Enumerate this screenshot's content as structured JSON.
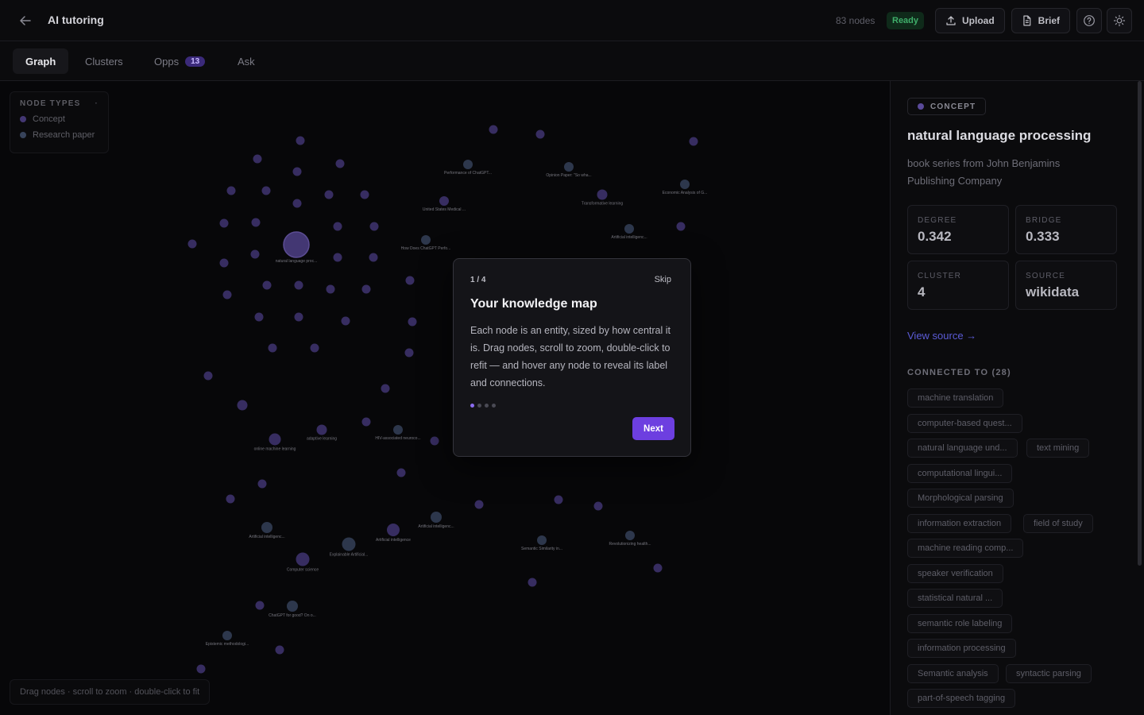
{
  "header": {
    "title": "AI tutoring",
    "node_count": "83 nodes",
    "status": "Ready",
    "upload_label": "Upload",
    "brief_label": "Brief"
  },
  "tabs": [
    {
      "label": "Graph"
    },
    {
      "label": "Clusters"
    },
    {
      "label": "Opps",
      "badge": "13"
    },
    {
      "label": "Ask"
    }
  ],
  "legend": {
    "title": "NODE TYPES",
    "items": [
      {
        "label": "Concept",
        "color": "#5a4a9a"
      },
      {
        "label": "Research paper",
        "color": "#4a5a7a"
      }
    ]
  },
  "graph_hint": "Drag nodes · scroll to zoom · double-click to fit",
  "graph": {
    "node_labels": [
      "natural language proc...",
      "Performance of ChatGPT...",
      "Opinion Paper: \"So wha...",
      "Economic Analysis of G...",
      "United States Medical ...",
      "Transformative learning",
      "How Does ChatGPT Perfo...",
      "Artificial intelligenc...",
      "online machine learning",
      "adaptive learning",
      "HIV-associated neuroco...",
      "Artificial intelligenc...",
      "Explainable Artificial...",
      "Artificial intelligence",
      "Artificial intelligenc...",
      "Semantic Similarity in...",
      "Revolutionizing health...",
      "Computer science",
      "ChatGPT for good? On o...",
      "Epistemic methodologi..."
    ]
  },
  "tour": {
    "step": "1 / 4",
    "skip": "Skip",
    "title": "Your knowledge map",
    "body": "Each node is an entity, sized by how central it is. Drag nodes, scroll to zoom, double-click to refit — and hover any node to reveal its label and connections.",
    "next": "Next",
    "current": 1,
    "total": 4
  },
  "panel": {
    "type": "CONCEPT",
    "title": "natural language processing",
    "description": "book series from John Benjamins Publishing Company",
    "stats": [
      {
        "label": "DEGREE",
        "value": "0.342"
      },
      {
        "label": "BRIDGE",
        "value": "0.333"
      },
      {
        "label": "CLUSTER",
        "value": "4"
      },
      {
        "label": "SOURCE",
        "value": "wikidata"
      }
    ],
    "view_source": "View source →",
    "connected_title": "CONNECTED TO (28)",
    "connections": [
      "machine translation",
      "computer-based quest...",
      "natural language und...",
      "text mining",
      "computational lingui...",
      "Morphological parsing",
      "information extraction",
      "field of study",
      "machine reading comp...",
      "speaker verification",
      "statistical natural ...",
      "semantic role labeling",
      "information processing",
      "Semantic analysis",
      "syntactic parsing",
      "part-of-speech tagging"
    ]
  },
  "colors": {
    "accent": "#6d3fe0",
    "concept": "#4a3d82",
    "paper": "#3d4a66",
    "status_ok": "#3fae6a"
  }
}
